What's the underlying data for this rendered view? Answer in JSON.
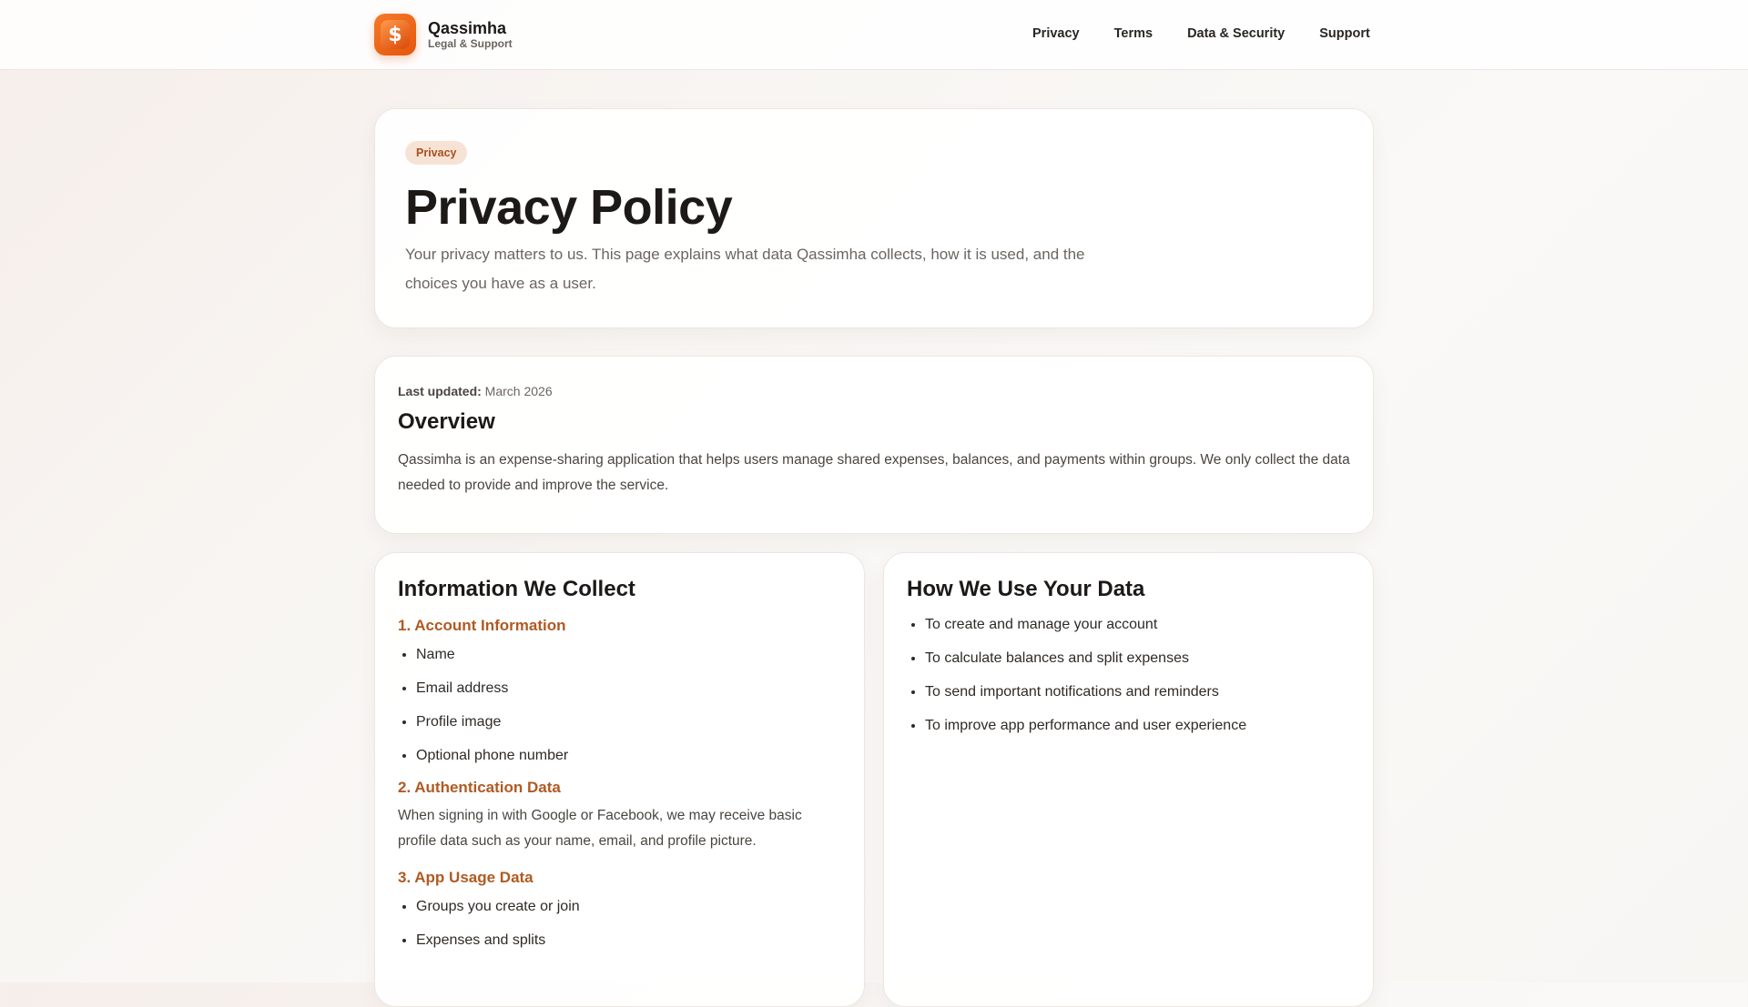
{
  "header": {
    "brand_name": "Qassimha",
    "brand_sub": "Legal & Support",
    "logo_symbol": "$",
    "nav": [
      "Privacy",
      "Terms",
      "Data & Security",
      "Support"
    ]
  },
  "hero": {
    "badge": "Privacy",
    "title": "Privacy Policy",
    "description": "Your privacy matters to us. This page explains what data Qassimha collects, how it is used, and the choices you have as a user."
  },
  "overview": {
    "updated_label": "Last updated:",
    "updated_value": "March 2026",
    "title": "Overview",
    "text": "Qassimha is an expense-sharing application that helps users manage shared expenses, balances, and payments within groups. We only collect the data needed to provide and improve the service."
  },
  "collect": {
    "title": "Information We Collect",
    "account_heading": "1. Account Information",
    "account_items": [
      "Name",
      "Email address",
      "Profile image",
      "Optional phone number"
    ],
    "auth_heading": "2. Authentication Data",
    "auth_text": "When signing in with Google or Facebook, we may receive basic profile data such as your name, email, and profile picture.",
    "usage_heading": "3. App Usage Data",
    "usage_items": [
      "Groups you create or join",
      "Expenses and splits"
    ]
  },
  "usage": {
    "title": "How We Use Your Data",
    "items": [
      "To create and manage your account",
      "To calculate balances and split expenses",
      "To send important notifications and reminders",
      "To improve app performance and user experience"
    ]
  },
  "colors": {
    "accent": "#e5560b",
    "subheading": "#b05a22",
    "badge_bg": "#f7e3d6"
  }
}
